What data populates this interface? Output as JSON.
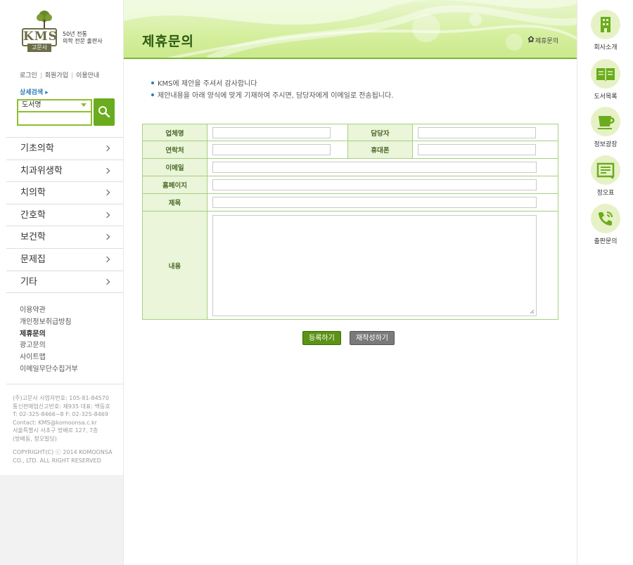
{
  "logo": {
    "brand": "KMS",
    "brand_sub": "고문사",
    "tagline_line1": "50년 전통",
    "tagline_line2": "의학 전문 출판사"
  },
  "top_links": [
    "로그인",
    "회원가입",
    "이용안내"
  ],
  "search": {
    "advanced": "상세검색 ▸",
    "select_value": "도서명",
    "input_value": ""
  },
  "categories": [
    "기초의학",
    "치과위생학",
    "치의학",
    "간호학",
    "보건학",
    "문제집",
    "기타"
  ],
  "sub_links": [
    "이용약관",
    "개인정보취급방침",
    "제휴문의",
    "광고문의",
    "사이트맵",
    "이메일무단수집거부"
  ],
  "company_info": {
    "line1": "(주)고문사  사업자번호: 105-81-84570",
    "line2": "통신판매업신고번호: 제935  대표: 백동호",
    "line3": "T: 02-325-8466~8  F: 02-325-8469",
    "line4": "Contact: KMS@komoonsa.c.kr",
    "line5": "서울특별시 서초구 방배로 127, 7층",
    "line6": "(방배동, 청오빌딩)",
    "copy1": "COPYRIGHT(C) ⓒ 2014 KOMOONSA",
    "copy2": "CO., LTD. ALL RIGHT RESERVED"
  },
  "page": {
    "title": "제휴문의",
    "breadcrumb_current": "제휴문의",
    "intro_1": "KMS에 제안을 주셔서 감사합니다",
    "intro_2": "제안내용을 아래 양식에 맞게 기재하여 주시면, 담당자에게 이메일로 전송됩니다."
  },
  "form": {
    "company_label": "업체명",
    "manager_label": "담당자",
    "contact_label": "연락처",
    "mobile_label": "휴대폰",
    "email_label": "이메일",
    "homepage_label": "홈페이지",
    "subject_label": "제목",
    "content_label": "내용",
    "submit": "등록하기",
    "reset": "재작성하기"
  },
  "quick_menu": [
    "회사소개",
    "도서목록",
    "정보광장",
    "정오표",
    "출판문의"
  ],
  "colors": {
    "accent_green": "#6aac1e",
    "header_green": "#2d5a12",
    "table_border": "#a7cf7f",
    "table_header_bg": "#eaf5da"
  }
}
